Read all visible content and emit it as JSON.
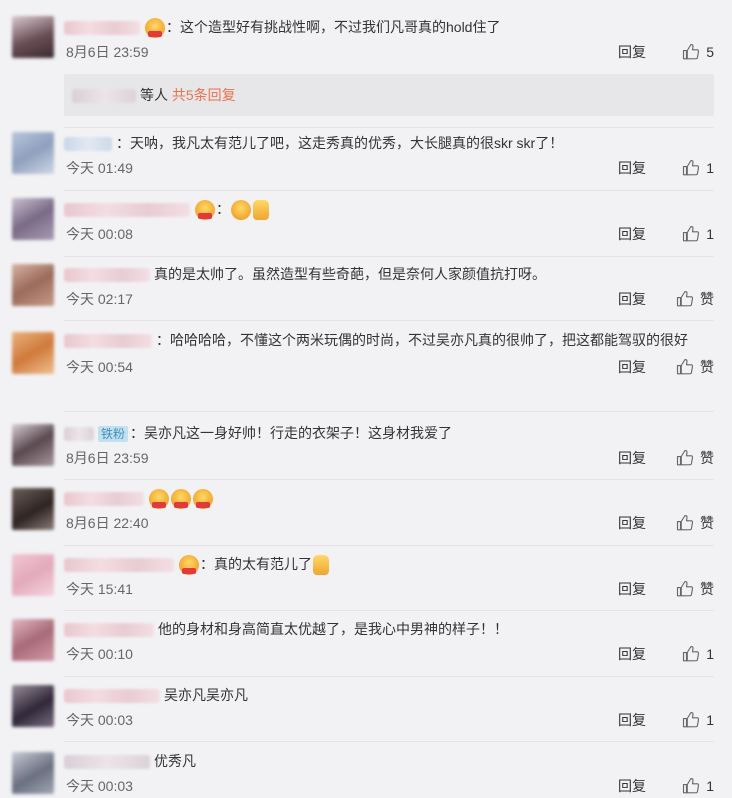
{
  "comments": [
    {
      "text": "：这个造型好有挑战性啊，不过我们凡哥真的hold住了",
      "time": "8月6日 23:59",
      "reply": "回复",
      "likes": "5"
    },
    {
      "text": "：天呐，我凡太有范儿了吧，这走秀真的优秀，大长腿真的很skr skr了！",
      "time": "今天 01:49",
      "reply": "回复",
      "likes": "1"
    },
    {
      "text": "：",
      "time": "今天 00:08",
      "reply": "回复",
      "likes": "1"
    },
    {
      "text": "真的是太帅了。虽然造型有些奇葩，但是奈何人家颜值抗打呀。",
      "time": "今天 02:17",
      "reply": "回复",
      "likes": "赞"
    },
    {
      "text": "：哈哈哈哈，不懂这个两米玩偶的时尚，不过吴亦凡真的很帅了，把这都能驾驭的很好",
      "time": "今天 00:54",
      "reply": "回复",
      "likes": "赞"
    },
    {
      "tag": "铁粉",
      "text": "：吴亦凡这一身好帅！行走的衣架子！这身材我爱了",
      "time": "8月6日 23:59",
      "reply": "回复",
      "likes": "赞"
    },
    {
      "text": "",
      "time": "8月6日 22:40",
      "reply": "回复",
      "likes": "赞"
    },
    {
      "text": "：真的太有范儿了",
      "time": "今天 15:41",
      "reply": "回复",
      "likes": "赞"
    },
    {
      "text": "他的身材和身高简直太优越了，是我心中男神的样子！！",
      "time": "今天 00:10",
      "reply": "回复",
      "likes": "1"
    },
    {
      "text": "吴亦凡吴亦凡",
      "time": "今天 00:03",
      "reply": "回复",
      "likes": "1"
    },
    {
      "text": "优秀凡",
      "time": "今天 00:03",
      "reply": "回复",
      "likes": "1"
    }
  ],
  "more_replies": {
    "who": "等人",
    "link": "共5条回复"
  },
  "colors": {
    "accent": "#eb7350",
    "background": "#f2f2f5"
  },
  "icons": {
    "like": "thumbs-up-icon",
    "emoji": "emoji-icon"
  }
}
